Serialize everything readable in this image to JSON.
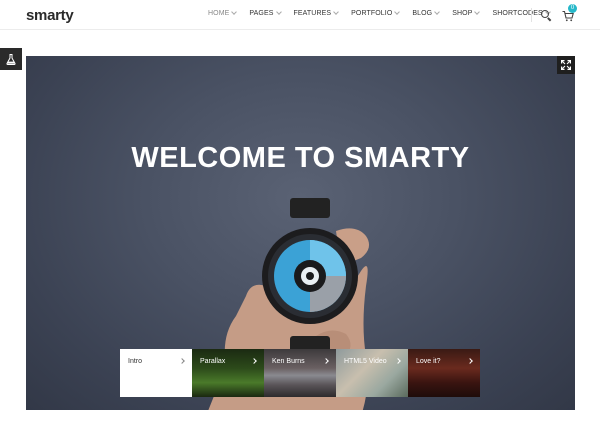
{
  "header": {
    "logo": "smarty",
    "nav": [
      {
        "label": "HOME",
        "active": true
      },
      {
        "label": "PAGES"
      },
      {
        "label": "FEATURES"
      },
      {
        "label": "PORTFOLIO"
      },
      {
        "label": "BLOG"
      },
      {
        "label": "SHOP"
      },
      {
        "label": "SHORTCODES"
      }
    ],
    "cart_count": "0"
  },
  "hero": {
    "title": "WELCOME TO SMARTY"
  },
  "thumbs": [
    {
      "label": "Intro"
    },
    {
      "label": "Parallax"
    },
    {
      "label": "Ken Burns"
    },
    {
      "label": "HTML5 Video"
    },
    {
      "label": "Love it?"
    }
  ],
  "colors": {
    "accent": "#26b8c9",
    "hero_bg": "#4a5264"
  }
}
